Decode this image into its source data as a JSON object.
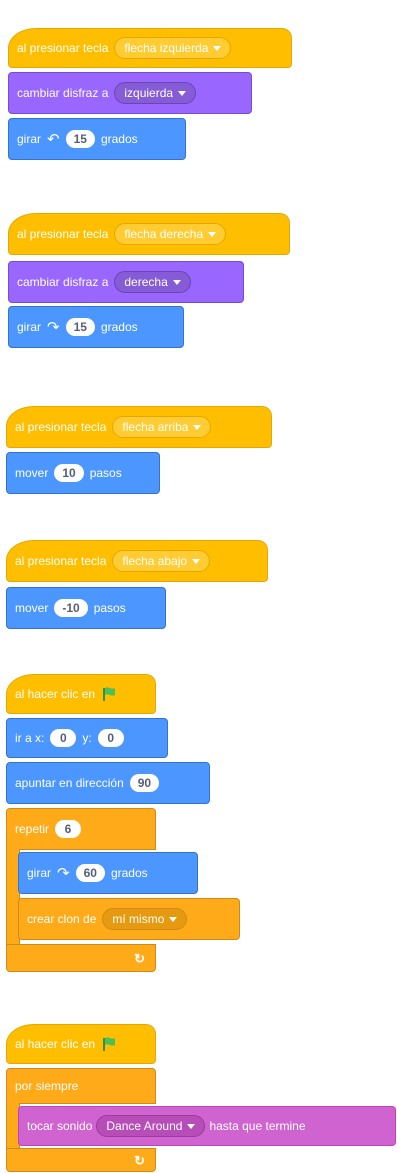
{
  "scripts": [
    {
      "hat": {
        "label": "al presionar tecla",
        "key": "flecha izquierda"
      },
      "costume": {
        "label": "cambiar disfraz a",
        "value": "izquierda"
      },
      "turn": {
        "label": "girar",
        "value": "15",
        "unit": "grados",
        "icon": "rotate-left-icon"
      }
    },
    {
      "hat": {
        "label": "al presionar tecla",
        "key": "flecha derecha"
      },
      "costume": {
        "label": "cambiar disfraz a",
        "value": "derecha"
      },
      "turn": {
        "label": "girar",
        "value": "15",
        "unit": "grados",
        "icon": "rotate-right-icon"
      }
    },
    {
      "hat": {
        "label": "al presionar tecla",
        "key": "flecha arriba"
      },
      "move": {
        "label": "mover",
        "value": "10",
        "unit": "pasos"
      }
    },
    {
      "hat": {
        "label": "al presionar tecla",
        "key": "flecha abajo"
      },
      "move": {
        "label": "mover",
        "value": "-10",
        "unit": "pasos"
      }
    },
    {
      "hat": {
        "label": "al hacer clic en",
        "icon": "green-flag-icon"
      },
      "goto": {
        "label": "ir a x:",
        "x": "0",
        "ylabel": "y:",
        "y": "0"
      },
      "point": {
        "label": "apuntar en dirección",
        "value": "90"
      },
      "repeat": {
        "label": "repetir",
        "value": "6"
      },
      "turn": {
        "label": "girar",
        "value": "60",
        "unit": "grados",
        "icon": "rotate-right-icon"
      },
      "clone": {
        "label": "crear clon de",
        "value": "mí mismo"
      }
    },
    {
      "hat": {
        "label": "al hacer clic en",
        "icon": "green-flag-icon"
      },
      "forever": {
        "label": "por siempre"
      },
      "sound": {
        "label": "tocar sonido",
        "value": "Dance Around",
        "suffix": "hasta que termine"
      }
    }
  ],
  "loop_icon": "loop-arrow-icon",
  "colors": {
    "events": "#FFBF00",
    "looks": "#9966FF",
    "motion": "#4C97FF",
    "control": "#FFAB19",
    "sound": "#CF63CF",
    "flag": "#4CBF56"
  }
}
